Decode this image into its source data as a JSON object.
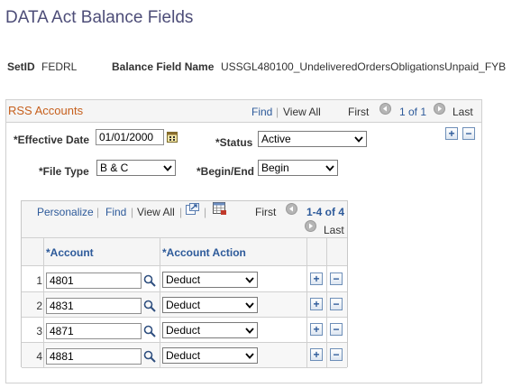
{
  "page": {
    "title": "DATA Act Balance Fields"
  },
  "header": {
    "setid_label": "SetID",
    "setid_value": "FEDRL",
    "balance_field_label": "Balance Field Name",
    "balance_field_value": "USSGL480100_UndeliveredOrdersObligationsUnpaid_FYB"
  },
  "rss": {
    "title": "RSS Accounts",
    "find": "Find",
    "sep": "|",
    "view_all": "View All",
    "first": "First",
    "count": "1 of 1",
    "last": "Last",
    "effective_date_label": "*Effective Date",
    "effective_date_value": "01/01/2000",
    "status_label": "*Status",
    "status_value": "Active",
    "file_type_label": "*File Type",
    "file_type_value": "B & C",
    "begin_end_label": "*Begin/End",
    "begin_end_value": "Begin",
    "add_symbol": "+",
    "remove_symbol": "−"
  },
  "grid": {
    "personalize": "Personalize",
    "find": "Find",
    "view_all": "View All",
    "sep": "|",
    "first": "First",
    "count": "1-4 of 4",
    "last": "Last",
    "col_account": "*Account",
    "col_action": "*Account Action",
    "rows": [
      {
        "num": "1",
        "account": "4801",
        "action": "Deduct"
      },
      {
        "num": "2",
        "account": "4831",
        "action": "Deduct"
      },
      {
        "num": "3",
        "account": "4871",
        "action": "Deduct"
      },
      {
        "num": "4",
        "account": "4881",
        "action": "Deduct"
      }
    ]
  },
  "colors": {
    "title": "#4d4d78",
    "section_title": "#c65f1c",
    "link": "#2d5a9a",
    "header_bg": "#f5f5f5"
  },
  "icons": [
    "calendar-icon",
    "lookup-icon",
    "first-arrow-icon",
    "last-arrow-icon",
    "zoom-icon",
    "download-grid-icon",
    "chevron-down-icon"
  ]
}
